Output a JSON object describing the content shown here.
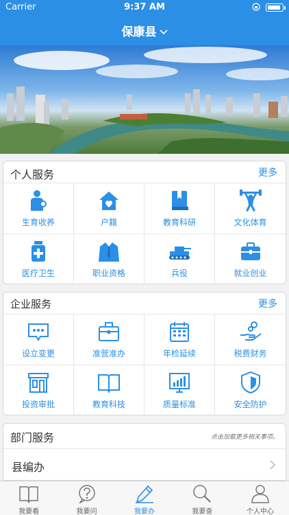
{
  "status": {
    "carrier": "Carrier",
    "time": "9:37 AM"
  },
  "header": {
    "title": "保康县"
  },
  "personal": {
    "title": "个人服务",
    "more": "更多",
    "items": [
      {
        "label": "生育收养",
        "icon": "family-icon"
      },
      {
        "label": "户籍",
        "icon": "house-icon"
      },
      {
        "label": "教育科研",
        "icon": "book-icon"
      },
      {
        "label": "文化体育",
        "icon": "weightlifting-icon"
      },
      {
        "label": "医疗卫生",
        "icon": "medicine-bottle-icon"
      },
      {
        "label": "职业资格",
        "icon": "suit-icon"
      },
      {
        "label": "兵役",
        "icon": "tank-icon"
      },
      {
        "label": "就业创业",
        "icon": "briefcase-icon"
      }
    ]
  },
  "enterprise": {
    "title": "企业服务",
    "more": "更多",
    "items": [
      {
        "label": "设立变更",
        "icon": "chat-bubble-icon"
      },
      {
        "label": "准营准办",
        "icon": "briefcase-outline-icon"
      },
      {
        "label": "年检延续",
        "icon": "calendar-icon"
      },
      {
        "label": "税费财务",
        "icon": "hand-coins-icon"
      },
      {
        "label": "投资审批",
        "icon": "shop-icon"
      },
      {
        "label": "教育科技",
        "icon": "open-book-icon"
      },
      {
        "label": "质量标准",
        "icon": "chart-screen-icon"
      },
      {
        "label": "安全防护",
        "icon": "shield-icon"
      }
    ]
  },
  "department": {
    "title": "部门服务",
    "hint": "点击加载更多相关事项。",
    "first_item": "县编办"
  },
  "tabs": [
    {
      "label": "我要看",
      "icon": "book-icon"
    },
    {
      "label": "我要问",
      "icon": "question-icon"
    },
    {
      "label": "我要办",
      "icon": "pencil-icon",
      "active": true
    },
    {
      "label": "我要查",
      "icon": "magnifier-icon"
    },
    {
      "label": "个人中心",
      "icon": "person-icon"
    }
  ],
  "colors": {
    "primary": "#2b8fe6",
    "background": "#f2f2f2"
  }
}
